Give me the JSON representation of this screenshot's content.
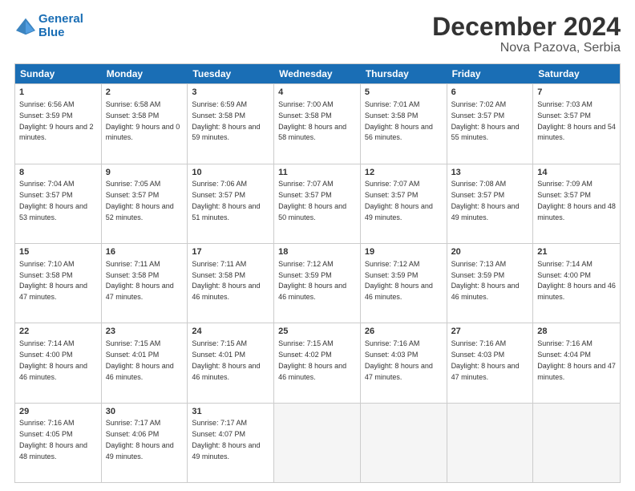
{
  "header": {
    "logo_line1": "General",
    "logo_line2": "Blue",
    "title": "December 2024",
    "subtitle": "Nova Pazova, Serbia"
  },
  "days": [
    "Sunday",
    "Monday",
    "Tuesday",
    "Wednesday",
    "Thursday",
    "Friday",
    "Saturday"
  ],
  "rows": [
    [
      {
        "day": "1",
        "info": "Sunrise: 6:56 AM\nSunset: 3:59 PM\nDaylight: 9 hours and 2 minutes."
      },
      {
        "day": "2",
        "info": "Sunrise: 6:58 AM\nSunset: 3:58 PM\nDaylight: 9 hours and 0 minutes."
      },
      {
        "day": "3",
        "info": "Sunrise: 6:59 AM\nSunset: 3:58 PM\nDaylight: 8 hours and 59 minutes."
      },
      {
        "day": "4",
        "info": "Sunrise: 7:00 AM\nSunset: 3:58 PM\nDaylight: 8 hours and 58 minutes."
      },
      {
        "day": "5",
        "info": "Sunrise: 7:01 AM\nSunset: 3:58 PM\nDaylight: 8 hours and 56 minutes."
      },
      {
        "day": "6",
        "info": "Sunrise: 7:02 AM\nSunset: 3:57 PM\nDaylight: 8 hours and 55 minutes."
      },
      {
        "day": "7",
        "info": "Sunrise: 7:03 AM\nSunset: 3:57 PM\nDaylight: 8 hours and 54 minutes."
      }
    ],
    [
      {
        "day": "8",
        "info": "Sunrise: 7:04 AM\nSunset: 3:57 PM\nDaylight: 8 hours and 53 minutes."
      },
      {
        "day": "9",
        "info": "Sunrise: 7:05 AM\nSunset: 3:57 PM\nDaylight: 8 hours and 52 minutes."
      },
      {
        "day": "10",
        "info": "Sunrise: 7:06 AM\nSunset: 3:57 PM\nDaylight: 8 hours and 51 minutes."
      },
      {
        "day": "11",
        "info": "Sunrise: 7:07 AM\nSunset: 3:57 PM\nDaylight: 8 hours and 50 minutes."
      },
      {
        "day": "12",
        "info": "Sunrise: 7:07 AM\nSunset: 3:57 PM\nDaylight: 8 hours and 49 minutes."
      },
      {
        "day": "13",
        "info": "Sunrise: 7:08 AM\nSunset: 3:57 PM\nDaylight: 8 hours and 49 minutes."
      },
      {
        "day": "14",
        "info": "Sunrise: 7:09 AM\nSunset: 3:57 PM\nDaylight: 8 hours and 48 minutes."
      }
    ],
    [
      {
        "day": "15",
        "info": "Sunrise: 7:10 AM\nSunset: 3:58 PM\nDaylight: 8 hours and 47 minutes."
      },
      {
        "day": "16",
        "info": "Sunrise: 7:11 AM\nSunset: 3:58 PM\nDaylight: 8 hours and 47 minutes."
      },
      {
        "day": "17",
        "info": "Sunrise: 7:11 AM\nSunset: 3:58 PM\nDaylight: 8 hours and 46 minutes."
      },
      {
        "day": "18",
        "info": "Sunrise: 7:12 AM\nSunset: 3:59 PM\nDaylight: 8 hours and 46 minutes."
      },
      {
        "day": "19",
        "info": "Sunrise: 7:12 AM\nSunset: 3:59 PM\nDaylight: 8 hours and 46 minutes."
      },
      {
        "day": "20",
        "info": "Sunrise: 7:13 AM\nSunset: 3:59 PM\nDaylight: 8 hours and 46 minutes."
      },
      {
        "day": "21",
        "info": "Sunrise: 7:14 AM\nSunset: 4:00 PM\nDaylight: 8 hours and 46 minutes."
      }
    ],
    [
      {
        "day": "22",
        "info": "Sunrise: 7:14 AM\nSunset: 4:00 PM\nDaylight: 8 hours and 46 minutes."
      },
      {
        "day": "23",
        "info": "Sunrise: 7:15 AM\nSunset: 4:01 PM\nDaylight: 8 hours and 46 minutes."
      },
      {
        "day": "24",
        "info": "Sunrise: 7:15 AM\nSunset: 4:01 PM\nDaylight: 8 hours and 46 minutes."
      },
      {
        "day": "25",
        "info": "Sunrise: 7:15 AM\nSunset: 4:02 PM\nDaylight: 8 hours and 46 minutes."
      },
      {
        "day": "26",
        "info": "Sunrise: 7:16 AM\nSunset: 4:03 PM\nDaylight: 8 hours and 47 minutes."
      },
      {
        "day": "27",
        "info": "Sunrise: 7:16 AM\nSunset: 4:03 PM\nDaylight: 8 hours and 47 minutes."
      },
      {
        "day": "28",
        "info": "Sunrise: 7:16 AM\nSunset: 4:04 PM\nDaylight: 8 hours and 47 minutes."
      }
    ],
    [
      {
        "day": "29",
        "info": "Sunrise: 7:16 AM\nSunset: 4:05 PM\nDaylight: 8 hours and 48 minutes."
      },
      {
        "day": "30",
        "info": "Sunrise: 7:17 AM\nSunset: 4:06 PM\nDaylight: 8 hours and 49 minutes."
      },
      {
        "day": "31",
        "info": "Sunrise: 7:17 AM\nSunset: 4:07 PM\nDaylight: 8 hours and 49 minutes."
      },
      null,
      null,
      null,
      null
    ]
  ]
}
